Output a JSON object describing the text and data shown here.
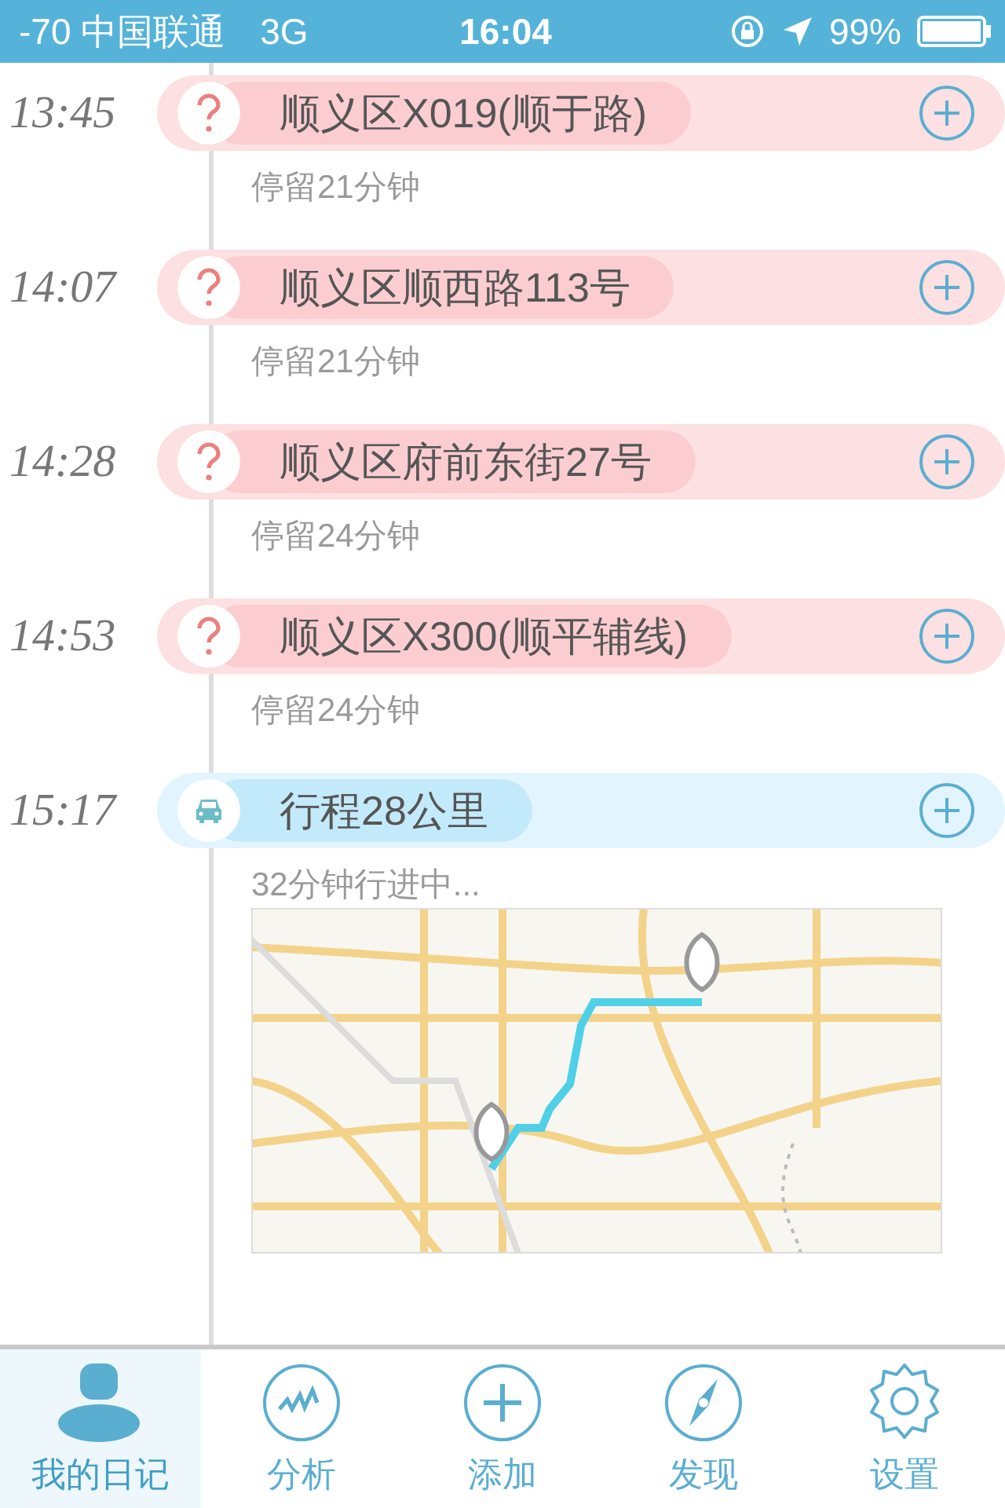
{
  "status_bar": {
    "carrier": "-70 中国联通",
    "network": "3G",
    "time": "16:04",
    "battery": "99%"
  },
  "timeline": [
    {
      "kind": "stop",
      "time": "13:45",
      "title": "顺义区X019(顺于路)",
      "detail": "停留21分钟"
    },
    {
      "kind": "stop",
      "time": "14:07",
      "title": "顺义区顺西路113号",
      "detail": "停留21分钟"
    },
    {
      "kind": "stop",
      "time": "14:28",
      "title": "顺义区府前东街27号",
      "detail": "停留24分钟"
    },
    {
      "kind": "stop",
      "time": "14:53",
      "title": "顺义区X300(顺平辅线)",
      "detail": "停留24分钟"
    },
    {
      "kind": "trip",
      "time": "15:17",
      "title": "行程28公里",
      "detail": "32分钟行进中..."
    }
  ],
  "tab_bar": [
    {
      "kind": "diary",
      "label": "我的日记",
      "selected": true
    },
    {
      "kind": "analysis",
      "label": "分析",
      "selected": false
    },
    {
      "kind": "add",
      "label": "添加",
      "selected": false
    },
    {
      "kind": "discover",
      "label": "发现",
      "selected": false
    },
    {
      "kind": "settings",
      "label": "设置",
      "selected": false
    }
  ]
}
